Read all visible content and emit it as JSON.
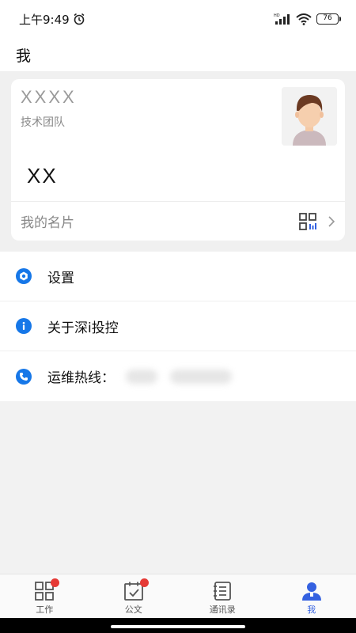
{
  "status_bar": {
    "time": "上午9:49",
    "battery": "76",
    "network_label": "HD"
  },
  "header": {
    "title": "我"
  },
  "profile": {
    "name_placeholder": "XXXX",
    "team": "技术团队",
    "display_name": "XX",
    "card_label": "我的名片"
  },
  "menu": {
    "items": [
      {
        "label": "设置",
        "icon": "gear-icon"
      },
      {
        "label": "关于深i投控",
        "icon": "info-icon"
      },
      {
        "label": "运维热线：",
        "icon": "phone-icon"
      }
    ]
  },
  "tabbar": {
    "items": [
      {
        "label": "工作",
        "icon": "grid-icon",
        "badge": true
      },
      {
        "label": "公文",
        "icon": "calendar-check-icon",
        "badge": true
      },
      {
        "label": "通讯录",
        "icon": "contacts-icon",
        "badge": false
      },
      {
        "label": "我",
        "icon": "person-icon",
        "active": true
      }
    ]
  },
  "colors": {
    "accent": "#1677e8",
    "active_tab": "#3461e0",
    "badge": "#e53935"
  }
}
